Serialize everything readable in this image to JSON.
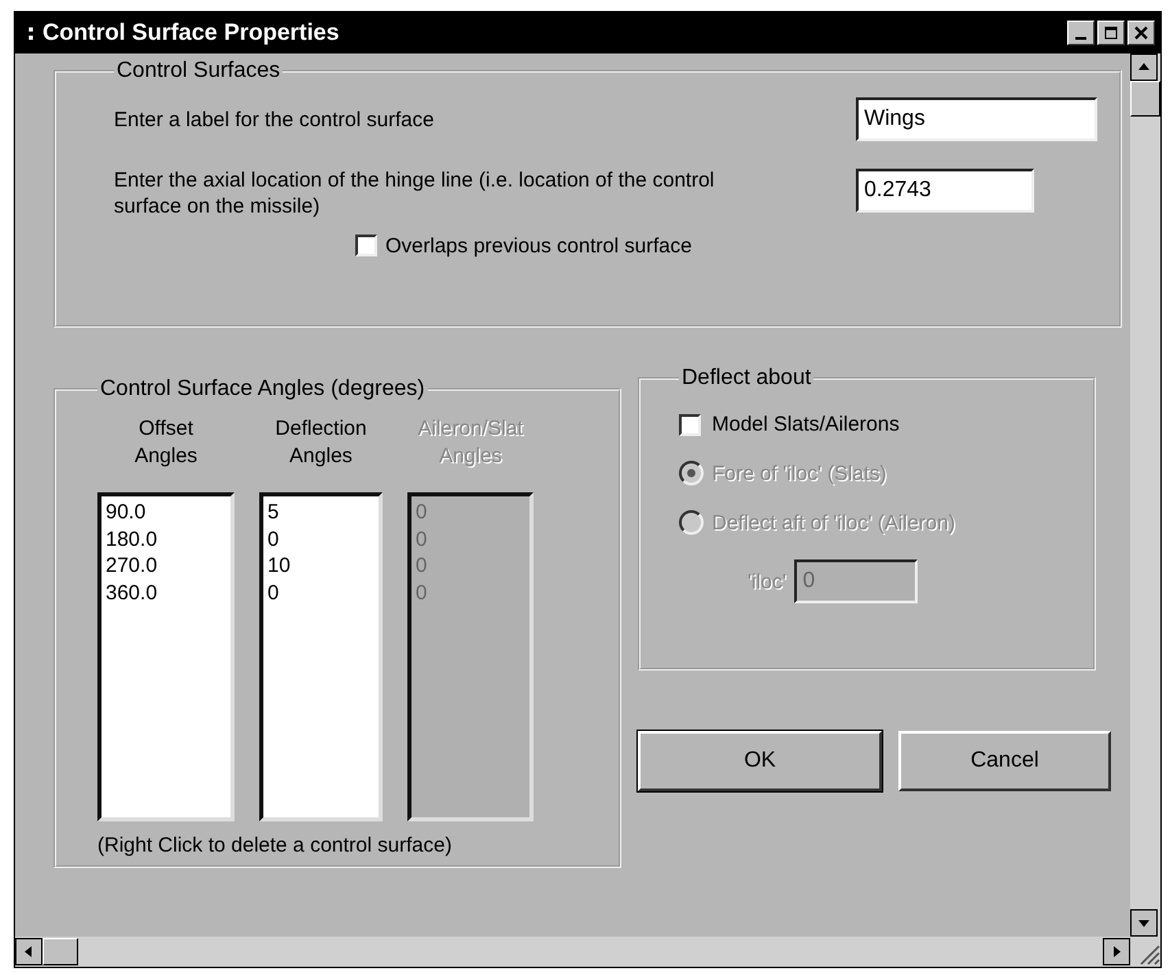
{
  "window": {
    "title": "Control Surface Properties"
  },
  "control_surfaces": {
    "title": "Control Surfaces",
    "label_prompt": "Enter a label for the control surface",
    "label_value": "Wings",
    "hinge_prompt": "Enter the axial location of the hinge line (i.e. location of the control surface on the missile)",
    "hinge_value": "0.2743",
    "overlaps": {
      "label": "Overlaps previous control surface",
      "checked": false
    }
  },
  "angles": {
    "title": "Control Surface Angles (degrees)",
    "columns": [
      {
        "heading": "Offset\nAngles",
        "disabled": false,
        "values": [
          "90.0",
          "180.0",
          "270.0",
          "360.0"
        ]
      },
      {
        "heading": "Deflection\nAngles",
        "disabled": false,
        "values": [
          "5",
          "0",
          "10",
          "0"
        ]
      },
      {
        "heading": "Aileron/Slat\nAngles",
        "disabled": true,
        "values": [
          "0",
          "0",
          "0",
          "0"
        ]
      }
    ],
    "note": "(Right Click to delete a control surface)"
  },
  "deflect": {
    "title": "Deflect about",
    "model": {
      "label": "Model Slats/Ailerons",
      "checked": false
    },
    "options": [
      {
        "label": "Fore of 'iloc' (Slats)",
        "selected": true,
        "disabled": true
      },
      {
        "label": "Deflect aft of 'iloc' (Aileron)",
        "selected": false,
        "disabled": true
      }
    ],
    "iloc": {
      "label": "'iloc'",
      "value": "0",
      "disabled": true
    }
  },
  "buttons": [
    {
      "label": "OK",
      "default": true
    },
    {
      "label": "Cancel",
      "default": false
    }
  ]
}
